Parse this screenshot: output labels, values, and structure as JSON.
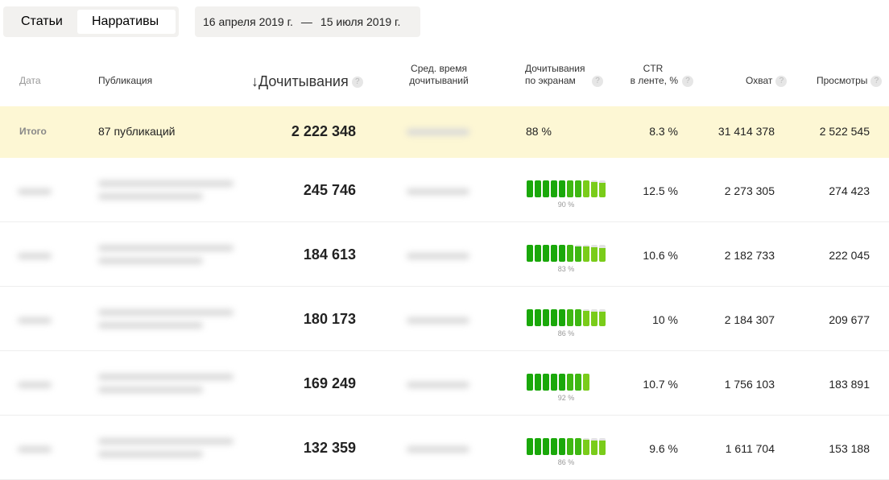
{
  "tabs": {
    "articles": "Статьи",
    "narratives": "Нарративы"
  },
  "date_range": {
    "from": "16 апреля 2019 г.",
    "sep": "—",
    "to": "15 июля 2019 г."
  },
  "headers": {
    "date": "Дата",
    "publication": "Публикация",
    "reads": "↓Дочитывания",
    "avg_time_1": "Сред. время",
    "avg_time_2": "дочитываний",
    "screens_1": "Дочитывания",
    "screens_2": "по экранам",
    "ctr_1": "CTR",
    "ctr_2": "в ленте, %",
    "reach": "Охват",
    "views": "Просмотры",
    "help": "?"
  },
  "total": {
    "label": "Итого",
    "publications": "87 публикаций",
    "reads": "2 222 348",
    "screens": "88 %",
    "ctr": "8.3 %",
    "reach": "31 414 378",
    "views": "2 522 545"
  },
  "rows": [
    {
      "reads": "245 746",
      "screens_pct": "90 %",
      "bars": [
        1,
        1,
        1,
        1,
        1,
        1,
        1,
        1,
        0.9,
        0.85
      ],
      "ctr": "12.5 %",
      "reach": "2 273 305",
      "views": "274 423"
    },
    {
      "reads": "184 613",
      "screens_pct": "83 %",
      "bars": [
        1,
        1,
        1,
        1,
        1,
        1,
        0.9,
        0.9,
        0.85,
        0.8
      ],
      "ctr": "10.6 %",
      "reach": "2 182 733",
      "views": "222 045"
    },
    {
      "reads": "180 173",
      "screens_pct": "86 %",
      "bars": [
        1,
        1,
        1,
        1,
        1,
        1,
        1,
        0.9,
        0.85,
        0.85
      ],
      "ctr": "10 %",
      "reach": "2 184 307",
      "views": "209 677"
    },
    {
      "reads": "169 249",
      "screens_pct": "92 %",
      "bars": [
        1,
        1,
        1,
        1,
        1,
        1,
        1,
        1
      ],
      "ctr": "10.7 %",
      "reach": "1 756 103",
      "views": "183 891"
    },
    {
      "reads": "132 359",
      "screens_pct": "86 %",
      "bars": [
        1,
        1,
        1,
        1,
        1,
        1,
        1,
        0.9,
        0.85,
        0.85
      ],
      "ctr": "9.6 %",
      "reach": "1 611 704",
      "views": "153 188"
    }
  ],
  "colors": {
    "dark_green": "#1aa80a",
    "light_green": "#7acc1a",
    "total_bg": "#fdf7d4"
  }
}
